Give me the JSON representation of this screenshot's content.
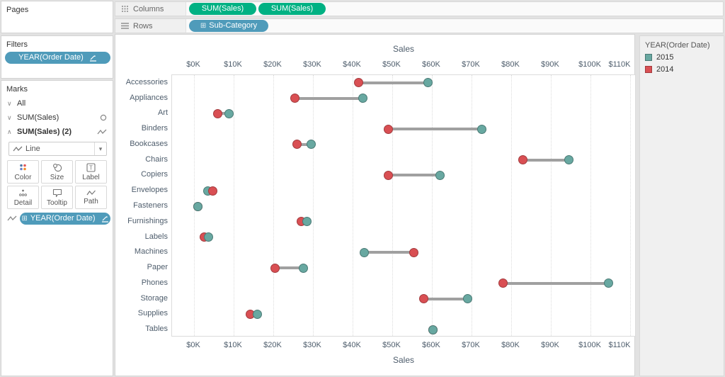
{
  "colors": {
    "accent_green_pill": "#00b183",
    "accent_blue_pill": "#4f9bba",
    "teal_2015": "#68a8a1",
    "teal_2015_border": "#4a7a75",
    "red_2014": "#d94f53",
    "red_2014_border": "#a23b3e",
    "connector_gray": "#a0a0a0"
  },
  "left_panel": {
    "pages_label": "Pages",
    "filters_label": "Filters",
    "filter_pill": {
      "label": "YEAR(Order Date)",
      "icon": "sort-glyph-icon"
    },
    "marks_label": "Marks",
    "marks_rows": [
      {
        "chevron": "∨",
        "label": "All",
        "right_icon": ""
      },
      {
        "chevron": "∨",
        "label": "SUM(Sales)",
        "right_icon": "circle-mark-icon"
      },
      {
        "chevron": "∧",
        "label": "SUM(Sales) (2)",
        "right_icon": "line-mark-icon",
        "bold": true
      }
    ],
    "mark_type_dropdown": {
      "value": "Line",
      "icon": "line-mark-icon",
      "caret": "▾"
    },
    "buttons": [
      {
        "label": "Color",
        "icon": "color-icon"
      },
      {
        "label": "Size",
        "icon": "size-icon"
      },
      {
        "label": "Label",
        "icon": "label-icon"
      },
      {
        "label": "Detail",
        "icon": "detail-icon"
      },
      {
        "label": "Tooltip",
        "icon": "tooltip-icon"
      },
      {
        "label": "Path",
        "icon": "path-icon"
      }
    ],
    "marks_pill": {
      "label": "YEAR(Order Date)",
      "left_icon": "⊞",
      "right_icon": "sort-glyph-icon"
    }
  },
  "shelves": {
    "columns_label": "Columns",
    "rows_label": "Rows",
    "columns_pills": [
      "SUM(Sales)",
      "SUM(Sales)"
    ],
    "rows_pills": [
      {
        "label": "Sub-Category",
        "left_icon": "⊞"
      }
    ]
  },
  "legend": {
    "title": "YEAR(Order Date)",
    "items": [
      {
        "label": "2015",
        "color": "#68a8a1",
        "border": "#4a7a75"
      },
      {
        "label": "2014",
        "color": "#d94f53",
        "border": "#a23b3e"
      }
    ]
  },
  "chart_data": {
    "type": "dumbbell (paired dot plot with gray connector lines, dual top/bottom x-axes)",
    "axis_title": "Sales",
    "units": "thousands of USD",
    "xlim": [
      0,
      110
    ],
    "tick_values": [
      0,
      10,
      20,
      30,
      40,
      50,
      60,
      70,
      80,
      90,
      100,
      110
    ],
    "tick_labels": [
      "$0K",
      "$10K",
      "$20K",
      "$30K",
      "$40K",
      "$50K",
      "$60K",
      "$70K",
      "$80K",
      "$90K",
      "$100K",
      "$110K"
    ],
    "grid": "vertical dotted gridlines at each tick",
    "legend_position": "top-right",
    "categories": [
      "Accessories",
      "Appliances",
      "Art",
      "Binders",
      "Bookcases",
      "Chairs",
      "Copiers",
      "Envelopes",
      "Fasteners",
      "Furnishings",
      "Labels",
      "Machines",
      "Paper",
      "Phones",
      "Storage",
      "Supplies",
      "Tables"
    ],
    "series": [
      {
        "name": "2014",
        "color": "#d94f53",
        "values": [
          41.5,
          25.5,
          6.0,
          49.0,
          26.0,
          83.0,
          49.0,
          4.8,
          0.9,
          27.0,
          2.6,
          55.5,
          20.5,
          78.0,
          58.0,
          14.2,
          60.2
        ]
      },
      {
        "name": "2015",
        "color": "#68a8a1",
        "values": [
          59.0,
          42.5,
          8.8,
          72.5,
          29.5,
          94.5,
          62.0,
          3.5,
          0.9,
          28.5,
          3.7,
          43.0,
          27.5,
          104.5,
          69.0,
          16.0,
          60.3
        ]
      }
    ]
  }
}
